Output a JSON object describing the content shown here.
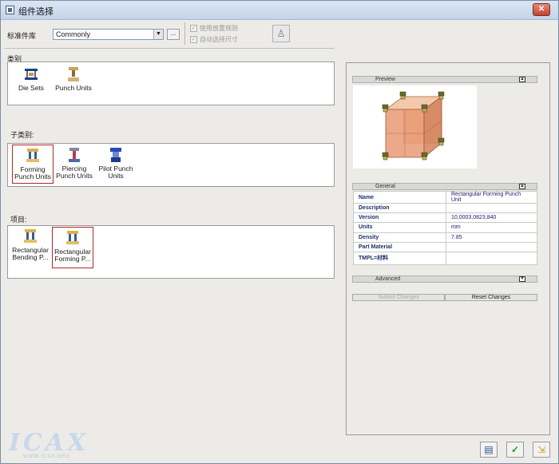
{
  "window": {
    "title": "组件选择",
    "close_label": "✕"
  },
  "toolbar": {
    "library_label": "标准件库",
    "library_value": "Commonly",
    "browse_label": "...",
    "placement_rules_label": "使用放置规则",
    "auto_size_label": "自动选择尺寸"
  },
  "category": {
    "label": "类别",
    "items": [
      {
        "label": "Die Sets",
        "icon": "die-sets-icon"
      },
      {
        "label": "Punch Units",
        "icon": "punch-units-icon"
      }
    ]
  },
  "subcategory": {
    "label": "子类别:",
    "items": [
      {
        "label": "Forming Punch Units",
        "icon": "forming-punch-icon",
        "selected": true
      },
      {
        "label": "Piercing Punch Units",
        "icon": "piercing-punch-icon",
        "selected": false
      },
      {
        "label": "Pilot Punch Units",
        "icon": "pilot-punch-icon",
        "selected": false
      }
    ]
  },
  "items_section": {
    "label": "项目:",
    "items": [
      {
        "label": "Rectangular Bending P...",
        "icon": "bending-punch-icon",
        "selected": false
      },
      {
        "label": "Rectangular Forming P...",
        "icon": "forming-punch-icon",
        "selected": true
      }
    ]
  },
  "preview": {
    "label": "Preview"
  },
  "general": {
    "label": "General",
    "rows": [
      {
        "key": "Name",
        "value": "Rectangular Forming Punch Unit"
      },
      {
        "key": "Description",
        "value": ""
      },
      {
        "key": "Version",
        "value": "10,0003,0823,840"
      },
      {
        "key": "Units",
        "value": "mm"
      },
      {
        "key": "Density",
        "value": "7.85"
      },
      {
        "key": "Part Material",
        "value": ""
      },
      {
        "key": "TMPL=材料",
        "value": ""
      }
    ]
  },
  "advanced": {
    "label": "Advanced"
  },
  "actions": {
    "submit_label": "Submit Changes",
    "reset_label": "Reset Changes"
  },
  "watermark": {
    "text": "ICAX",
    "subtext": "WWW.ICAX.ORG"
  },
  "colors": {
    "selection_border": "#b3262a",
    "accent": "#3a6ea5"
  }
}
